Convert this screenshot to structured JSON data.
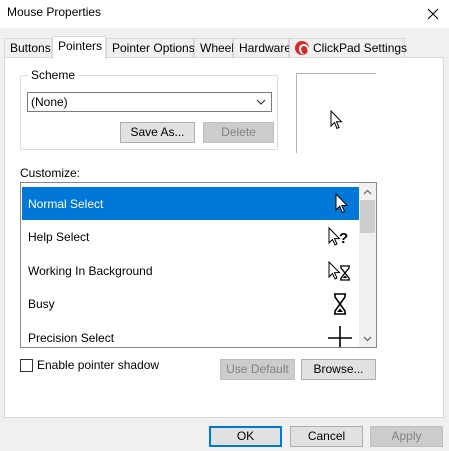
{
  "window": {
    "title": "Mouse Properties",
    "close_icon": "close-icon"
  },
  "tabs": [
    {
      "label": "Buttons"
    },
    {
      "label": "Pointers",
      "active": true
    },
    {
      "label": "Pointer Options"
    },
    {
      "label": "Wheel"
    },
    {
      "label": "Hardware"
    },
    {
      "label": "ClickPad Settings",
      "icon": "clickpad-icon"
    }
  ],
  "scheme": {
    "legend": "Scheme",
    "selected": "(None)",
    "save_as_label": "Save As...",
    "delete_label": "Delete"
  },
  "customize": {
    "label": "Customize:",
    "items": [
      {
        "label": "Normal Select",
        "icon": "arrow-cursor-icon",
        "selected": true
      },
      {
        "label": "Help Select",
        "icon": "help-cursor-icon"
      },
      {
        "label": "Working In Background",
        "icon": "working-cursor-icon"
      },
      {
        "label": "Busy",
        "icon": "hourglass-icon"
      },
      {
        "label": "Precision Select",
        "icon": "crosshair-icon"
      }
    ]
  },
  "options": {
    "enable_shadow_label": "Enable pointer shadow",
    "enable_shadow_checked": false,
    "use_default_label": "Use Default",
    "browse_label": "Browse..."
  },
  "footer": {
    "ok_label": "OK",
    "cancel_label": "Cancel",
    "apply_label": "Apply"
  },
  "colors": {
    "selection": "#0078d7",
    "clickpad_brand": "#d62b2b"
  }
}
